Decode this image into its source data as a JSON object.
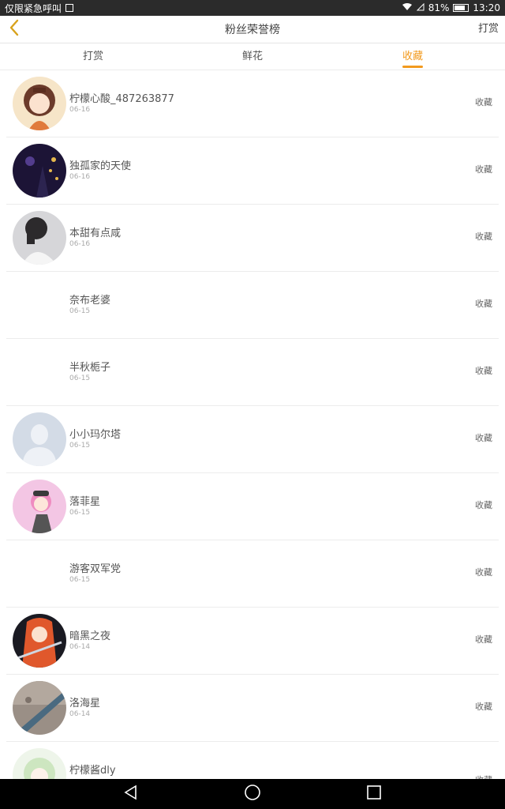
{
  "status_bar": {
    "emergency_text": "仅限紧急呼叫",
    "battery_text": "81%",
    "battery_level": 0.81,
    "time": "13:20",
    "icons": [
      "message-icon",
      "wifi-icon",
      "no-sim-icon",
      "battery-icon"
    ]
  },
  "header": {
    "title": "粉丝荣誉榜",
    "back_icon": "chevron-left-icon",
    "action_label": "打赏",
    "accent_color": "#f29a1e"
  },
  "tabs": [
    {
      "label": "打赏",
      "active": false
    },
    {
      "label": "鲜花",
      "active": false
    },
    {
      "label": "收藏",
      "active": true
    }
  ],
  "list": {
    "items": [
      {
        "name": "柠檬心酸_487263877",
        "date": "06-16",
        "action": "收藏",
        "avatar": "anime-girl-avatar"
      },
      {
        "name": "独孤家的天使",
        "date": "06-16",
        "action": "收藏",
        "avatar": "dark-photo-avatar"
      },
      {
        "name": "本甜有点咸",
        "date": "06-16",
        "action": "收藏",
        "avatar": "girl-photo-avatar"
      },
      {
        "name": "奈布老婆",
        "date": "06-15",
        "action": "收藏",
        "avatar": "none"
      },
      {
        "name": "半秋栀子",
        "date": "06-15",
        "action": "收藏",
        "avatar": "none"
      },
      {
        "name": "小小玛尔塔",
        "date": "06-15",
        "action": "收藏",
        "avatar": "default-user-avatar"
      },
      {
        "name": "落菲星",
        "date": "06-15",
        "action": "收藏",
        "avatar": "anime-pink-avatar"
      },
      {
        "name": "游客双军党",
        "date": "06-15",
        "action": "收藏",
        "avatar": "none"
      },
      {
        "name": "暗黑之夜",
        "date": "06-14",
        "action": "收藏",
        "avatar": "anime-red-avatar"
      },
      {
        "name": "洛海星",
        "date": "06-14",
        "action": "收藏",
        "avatar": "rock-photo-avatar"
      },
      {
        "name": "柠檬酱dly",
        "date": "",
        "action": "收藏",
        "avatar": "anime-green-avatar"
      }
    ]
  },
  "nav_bar": {
    "icons": [
      "back-triangle-icon",
      "home-circle-icon",
      "recents-square-icon"
    ]
  }
}
